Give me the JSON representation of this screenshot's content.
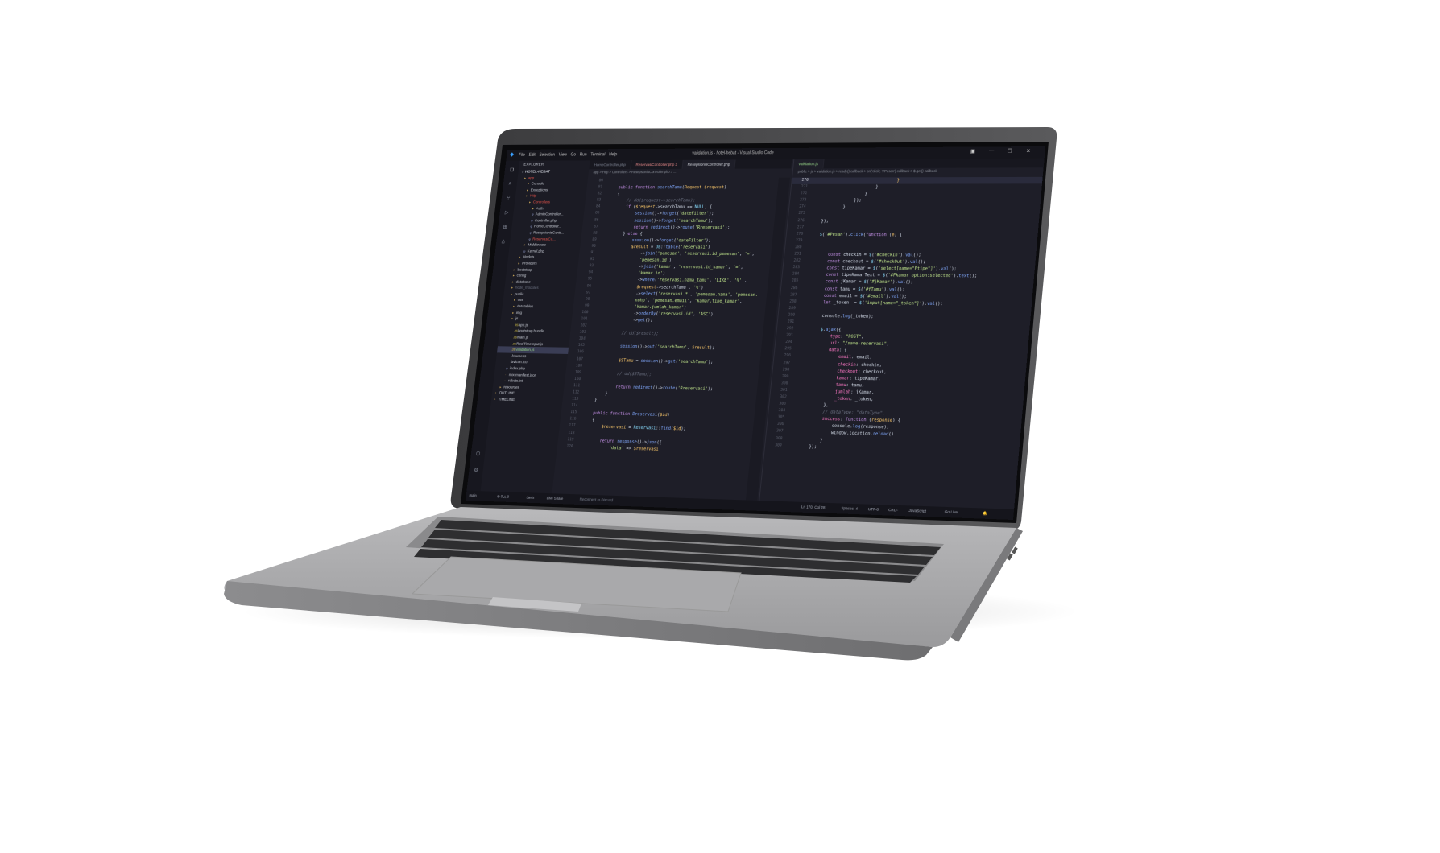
{
  "window": {
    "title": "validation.js - hotel-hebat - Visual Studio Code",
    "menu": [
      "File",
      "Edit",
      "Selection",
      "View",
      "Go",
      "Run",
      "Terminal",
      "Help"
    ]
  },
  "explorer": {
    "header": "EXPLORER",
    "project": "HOTEL-HEBAT",
    "items": [
      {
        "label": "app",
        "depth": 1,
        "type": "folder",
        "color": "#e5534b"
      },
      {
        "label": "Console",
        "depth": 2,
        "type": "folder",
        "color": "#c9cdd6"
      },
      {
        "label": "Exceptions",
        "depth": 2,
        "type": "folder",
        "color": "#c9cdd6"
      },
      {
        "label": "Http",
        "depth": 2,
        "type": "folder",
        "color": "#e5534b"
      },
      {
        "label": "Controllers",
        "depth": 3,
        "type": "folder",
        "color": "#e5534b"
      },
      {
        "label": "Auth",
        "depth": 4,
        "type": "folder",
        "color": "#c9cdd6"
      },
      {
        "label": "AdminController...",
        "depth": 4,
        "type": "php",
        "color": "#c9cdd6"
      },
      {
        "label": "Controller.php",
        "depth": 4,
        "type": "php",
        "color": "#c9cdd6"
      },
      {
        "label": "HomeController...",
        "depth": 4,
        "type": "php",
        "color": "#c9cdd6"
      },
      {
        "label": "ResepsionisContr...",
        "depth": 4,
        "type": "php",
        "color": "#c9cdd6"
      },
      {
        "label": "ReservasiCo...",
        "depth": 4,
        "type": "php",
        "color": "#e5534b"
      },
      {
        "label": "Middleware",
        "depth": 3,
        "type": "folder",
        "color": "#c9cdd6"
      },
      {
        "label": "Kernel.php",
        "depth": 3,
        "type": "php",
        "color": "#c9cdd6"
      },
      {
        "label": "Models",
        "depth": 2,
        "type": "folder",
        "color": "#c9cdd6"
      },
      {
        "label": "Providers",
        "depth": 2,
        "type": "folder",
        "color": "#c9cdd6"
      },
      {
        "label": "bootstrap",
        "depth": 1,
        "type": "folder",
        "color": "#c9cdd6"
      },
      {
        "label": "config",
        "depth": 1,
        "type": "folder",
        "color": "#c9cdd6"
      },
      {
        "label": "database",
        "depth": 1,
        "type": "folder",
        "color": "#c9cdd6"
      },
      {
        "label": "node_modules",
        "depth": 1,
        "type": "folder",
        "color": "#6b7080"
      },
      {
        "label": "public",
        "depth": 1,
        "type": "folder",
        "color": "#c9cdd6"
      },
      {
        "label": "css",
        "depth": 2,
        "type": "folder",
        "color": "#c9cdd6"
      },
      {
        "label": "datatables",
        "depth": 2,
        "type": "folder",
        "color": "#c9cdd6"
      },
      {
        "label": "img",
        "depth": 2,
        "type": "folder",
        "color": "#c9cdd6"
      },
      {
        "label": "js",
        "depth": 2,
        "type": "folder",
        "color": "#c9cdd6"
      },
      {
        "label": "app.js",
        "depth": 3,
        "type": "js",
        "color": "#c9cdd6"
      },
      {
        "label": "bootstrap.bundle....",
        "depth": 3,
        "type": "js",
        "color": "#c9cdd6"
      },
      {
        "label": "main.js",
        "depth": 3,
        "type": "js",
        "color": "#c9cdd6"
      },
      {
        "label": "RealTimeInput.js",
        "depth": 3,
        "type": "js",
        "color": "#c9cdd6"
      },
      {
        "label": "validation.js",
        "depth": 3,
        "type": "js",
        "color": "#9cdc8c",
        "selected": true
      },
      {
        "label": ".htaccess",
        "depth": 2,
        "type": "file",
        "color": "#c9cdd6"
      },
      {
        "label": "favicon.ico",
        "depth": 2,
        "type": "file",
        "color": "#c9cdd6"
      },
      {
        "label": "index.php",
        "depth": 2,
        "type": "php",
        "color": "#c9cdd6"
      },
      {
        "label": "mix-manifest.json",
        "depth": 2,
        "type": "file",
        "color": "#c9cdd6"
      },
      {
        "label": "robots.txt",
        "depth": 2,
        "type": "file",
        "color": "#c9cdd6"
      },
      {
        "label": "resources",
        "depth": 1,
        "type": "folder",
        "color": "#c9cdd6"
      },
      {
        "label": "OUTLINE",
        "depth": 0,
        "type": "section",
        "color": "#c9cdd6"
      },
      {
        "label": "TIMELINE",
        "depth": 0,
        "type": "section",
        "color": "#c9cdd6"
      }
    ]
  },
  "editor_left": {
    "tabs": [
      {
        "label": "HomeController.php",
        "state": "inactive"
      },
      {
        "label": "ReservasiController.php 3",
        "state": "modified"
      },
      {
        "label": "ResepsionisController.php",
        "state": "active"
      }
    ],
    "breadcrumb": "app > Http > Controllers > ResepsionisController.php > ...",
    "lines": [
      {
        "n": "80",
        "html": ""
      },
      {
        "n": "81",
        "html": "    <span class='kw'>public function</span> <span class='fn'>searchTamu</span>(<span class='var'>Request $request</span>)"
      },
      {
        "n": "82",
        "html": "    {"
      },
      {
        "n": "83",
        "html": "        <span class='cm'>// dd($request->searchTamu);</span>"
      },
      {
        "n": "84",
        "html": "        <span class='kw'>if</span> (<span class='var'>$request</span>-><span class='pl'>searchTamu</span> == <span class='op'>NULL</span>) {"
      },
      {
        "n": "85",
        "html": "            <span class='fn'>session</span>()-><span class='fn'>forget</span>(<span class='str'>'dateFilter'</span>);"
      },
      {
        "n": "86",
        "html": "            <span class='fn'>session</span>()-><span class='fn'>forget</span>(<span class='str'>'searchTamu'</span>);"
      },
      {
        "n": "87",
        "html": "            <span class='kw'>return</span> <span class='fn'>redirect</span>()-><span class='fn'>route</span>(<span class='str'>'Rreservasi'</span>);"
      },
      {
        "n": "88",
        "html": "        } <span class='kw'>else</span> {"
      },
      {
        "n": "89",
        "html": "            <span class='fn'>session</span>()-><span class='fn'>forget</span>(<span class='str'>'dateFilter'</span>);"
      },
      {
        "n": "90",
        "html": "            <span class='var'>$result</span> = <span class='op'>DB</span>::<span class='fn'>table</span>(<span class='str'>'reservasi'</span>)"
      },
      {
        "n": "91",
        "html": "                -><span class='fn'>join</span>(<span class='str'>'pemesan'</span>, <span class='str'>'reservasi.id_pemesan'</span>, <span class='str'>'='</span>,"
      },
      {
        "n": "92",
        "html": "                <span class='str'>'pemesan.id'</span>)"
      },
      {
        "n": "93",
        "html": "                -><span class='fn'>join</span>(<span class='str'>'kamar'</span>, <span class='str'>'reservasi.id_kamar'</span>, <span class='str'>'='</span>,"
      },
      {
        "n": "94",
        "html": "                <span class='str'>'kamar.id'</span>)"
      },
      {
        "n": "95",
        "html": "                -><span class='fn'>where</span>(<span class='str'>'reservasi.nama_tamu'</span>, <span class='str'>'LIKE'</span>, <span class='str'>'%'</span> ."
      },
      {
        "n": "96",
        "html": "                <span class='var'>$request</span>-><span class='pl'>searchTamu</span> . <span class='str'>'%'</span>)"
      },
      {
        "n": "97",
        "html": "                -><span class='fn'>select</span>(<span class='str'>'reservasi.*'</span>, <span class='str'>'pemesan.nama'</span>, <span class='str'>'pemesan.</span>"
      },
      {
        "n": "98",
        "html": "                <span class='str'>nohp'</span>, <span class='str'>'pemesan.email'</span>, <span class='str'>'kamar.tipe_kamar'</span>,"
      },
      {
        "n": "99",
        "html": "                <span class='str'>'kamar.jumlah_kamar'</span>)"
      },
      {
        "n": "100",
        "html": "                -><span class='fn'>orderBy</span>(<span class='str'>'reservasi.id'</span>, <span class='str'>'ASC'</span>)"
      },
      {
        "n": "101",
        "html": "                -><span class='fn'>get</span>();"
      },
      {
        "n": "102",
        "html": ""
      },
      {
        "n": "103",
        "html": "            <span class='cm'>// dd($result);</span>"
      },
      {
        "n": "104",
        "html": ""
      },
      {
        "n": "105",
        "html": "            <span class='fn'>session</span>()-><span class='fn'>put</span>(<span class='str'>'searchTamu'</span>, <span class='var'>$result</span>);"
      },
      {
        "n": "106",
        "html": ""
      },
      {
        "n": "107",
        "html": "            <span class='var'>$STamu</span> = <span class='fn'>session</span>()-><span class='fn'>get</span>(<span class='str'>'searchTamu'</span>);"
      },
      {
        "n": "108",
        "html": ""
      },
      {
        "n": "109",
        "html": "            <span class='cm'>// dd($STamu);</span>"
      },
      {
        "n": "110",
        "html": ""
      },
      {
        "n": "111",
        "html": "            <span class='kw'>return</span> <span class='fn'>redirect</span>()-><span class='fn'>route</span>(<span class='str'>'Rreservasi'</span>);"
      },
      {
        "n": "112",
        "html": "        }"
      },
      {
        "n": "113",
        "html": "    }"
      },
      {
        "n": "114",
        "html": ""
      },
      {
        "n": "115",
        "html": "    <span class='kw'>public function</span> <span class='fn'>Dreservasi</span>(<span class='var'>$id</span>)"
      },
      {
        "n": "116",
        "html": "    {"
      },
      {
        "n": "117",
        "html": "        <span class='var'>$reservasi</span> = <span class='op'>Reservasi</span>::<span class='fn'>find</span>(<span class='var'>$id</span>);"
      },
      {
        "n": "118",
        "html": ""
      },
      {
        "n": "119",
        "html": "        <span class='kw'>return</span> <span class='fn'>response</span>()-><span class='fn'>json</span>(["
      },
      {
        "n": "120",
        "html": "            <span class='str'>'data'</span> => <span class='var'>$reservasi</span>"
      }
    ]
  },
  "editor_right": {
    "tabs": [
      {
        "label": "validation.js",
        "state": "active"
      }
    ],
    "breadcrumb": "public > js > validation.js > ready() callback > on('click', '#Pesan') callback > $.get() callback",
    "lines": [
      {
        "n": "270",
        "html": "                                <span class='var'>}</span>",
        "cursor": true
      },
      {
        "n": "271",
        "html": "                        }"
      },
      {
        "n": "272",
        "html": "                    }"
      },
      {
        "n": "273",
        "html": "                });"
      },
      {
        "n": "274",
        "html": "            }"
      },
      {
        "n": "275",
        "html": ""
      },
      {
        "n": "276",
        "html": "    });"
      },
      {
        "n": "277",
        "html": ""
      },
      {
        "n": "278",
        "html": "    <span class='op'>$</span>(<span class='str'>'#Pesan'</span>).<span class='fn'>click</span>(<span class='kw'>function</span> (<span class='var'>e</span>) {"
      },
      {
        "n": "279",
        "html": ""
      },
      {
        "n": "280",
        "html": ""
      },
      {
        "n": "281",
        "html": "        <span class='kw'>const</span> <span class='pl'>checkin</span> = <span class='op'>$</span>(<span class='str'>'#checkIn'</span>).<span class='fn'>val</span>();"
      },
      {
        "n": "282",
        "html": "        <span class='kw'>const</span> <span class='pl'>checkout</span> = <span class='op'>$</span>(<span class='str'>'#checkOut'</span>).<span class='fn'>val</span>();"
      },
      {
        "n": "283",
        "html": "        <span class='kw'>const</span> <span class='pl'>tipeKamar</span> = <span class='op'>$</span>(<span class='str'>'select[name=\"Ftipe\"]'</span>).<span class='fn'>val</span>();"
      },
      {
        "n": "284",
        "html": "        <span class='kw'>const</span> <span class='pl'>tipeKamarText</span> = <span class='op'>$</span>(<span class='str'>'#Fkamar option:selected'</span>).<span class='fn'>text</span>();"
      },
      {
        "n": "285",
        "html": "        <span class='kw'>const</span> <span class='pl'>jKamar</span> = <span class='op'>$</span>(<span class='str'>'#jKamar'</span>).<span class='fn'>val</span>();"
      },
      {
        "n": "286",
        "html": "        <span class='kw'>const</span> <span class='pl'>tamu</span> = <span class='op'>$</span>(<span class='str'>'#fTamu'</span>).<span class='fn'>val</span>();"
      },
      {
        "n": "287",
        "html": "        <span class='kw'>const</span> <span class='pl'>email</span> = <span class='op'>$</span>(<span class='str'>'#email'</span>).<span class='fn'>val</span>();"
      },
      {
        "n": "288",
        "html": "        <span class='kw'>let</span> <span class='pl'>_token</span>  = <span class='op'>$</span>(<span class='str'>'input[name=\"_token\"]'</span>).<span class='fn'>val</span>();"
      },
      {
        "n": "289",
        "html": ""
      },
      {
        "n": "290",
        "html": "        <span class='pl'>console</span>.<span class='fn'>log</span>(<span class='pl'>_token</span>);"
      },
      {
        "n": "291",
        "html": ""
      },
      {
        "n": "292",
        "html": "        <span class='op'>$</span>.<span class='fn'>ajax</span>({"
      },
      {
        "n": "293",
        "html": "            <span class='pk'>type</span>: <span class='str'>\"POST\"</span>,"
      },
      {
        "n": "294",
        "html": "            <span class='pk'>url</span>: <span class='str'>\"/save-reservasi\"</span>,"
      },
      {
        "n": "295",
        "html": "            <span class='pk'>data</span>: {"
      },
      {
        "n": "296",
        "html": "                <span class='pk'>email</span>: <span class='pl'>email</span>,"
      },
      {
        "n": "297",
        "html": "                <span class='pk'>checkin</span>: <span class='pl'>checkin</span>,"
      },
      {
        "n": "298",
        "html": "                <span class='pk'>checkout</span>: <span class='pl'>checkout</span>,"
      },
      {
        "n": "299",
        "html": "                <span class='pk'>kamar</span>: <span class='pl'>tipeKamar</span>,"
      },
      {
        "n": "300",
        "html": "                <span class='pk'>tamu</span>: <span class='pl'>tamu</span>,"
      },
      {
        "n": "301",
        "html": "                <span class='pk'>jumlah</span>: <span class='pl'>jKamar</span>,"
      },
      {
        "n": "302",
        "html": "                <span class='pk'>_token</span>: <span class='pl'>_token</span>,"
      },
      {
        "n": "303",
        "html": "            },"
      },
      {
        "n": "304",
        "html": "            <span class='cm'>// dataType: \"dataType\",</span>"
      },
      {
        "n": "305",
        "html": "            <span class='pk'>success</span>: <span class='kw'>function</span> (<span class='var'>response</span>) {"
      },
      {
        "n": "306",
        "html": "                <span class='pl'>console</span>.<span class='fn'>log</span>(<span class='pl'>response</span>);"
      },
      {
        "n": "307",
        "html": "                <span class='pl'>window</span>.<span class='pl'>location</span>.<span class='fn'>reload</span>()"
      },
      {
        "n": "308",
        "html": "            }"
      },
      {
        "n": "309",
        "html": "        });"
      }
    ]
  },
  "statusbar": {
    "branch": "main",
    "problems": "⊗ 0 △ 0",
    "extra": "Javis",
    "liveshare": "Live Share",
    "discord": "Reconnect to Discord",
    "position": "Ln 170, Col 28",
    "spaces": "Spaces: 4",
    "encoding": "UTF-8",
    "eol": "CRLF",
    "language": "JavaScript",
    "golive": "Go Live"
  },
  "colors": {
    "editor_bg": "#1e1e28",
    "sidebar_bg": "#1b1b24",
    "accent_red": "#e5534b",
    "accent_green": "#9cdc8c",
    "laptop_body": "#a5a5a5"
  }
}
